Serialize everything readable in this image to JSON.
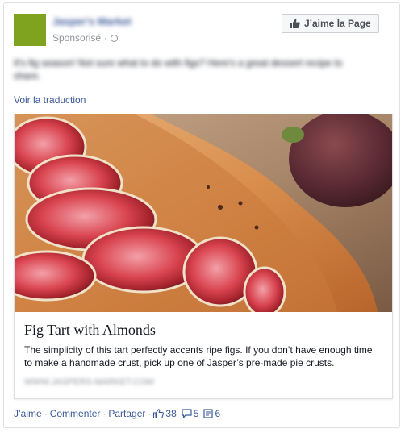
{
  "page": {
    "name": "Jasper's Market",
    "sponsored_label": "Sponsorisé",
    "like_page_button": "J’aime la Page"
  },
  "post": {
    "text": "It's fig season! Not sure what to do with figs? Here's a great dessert recipe to share.",
    "translate_link": "Voir la traduction"
  },
  "attachment": {
    "title": "Fig Tart with Almonds",
    "description": "The simplicity of this tart perfectly accents ripe figs. If you don’t have enough time to make a handmade crust, pick up one of Jasper’s pre-made pie crusts.",
    "domain": "WWW.JASPERS-MARKET.COM"
  },
  "actions": {
    "like": "J’aime",
    "comment": "Commenter",
    "share": "Partager",
    "separator": "·",
    "likes_count": "38",
    "comments_count": "5",
    "shares_count": "6"
  },
  "colors": {
    "link": "#3b5998",
    "avatar": "#7fa21f",
    "border": "#dddfe2",
    "muted": "#90949c"
  },
  "icons": [
    "thumbs-up-icon",
    "globe-icon",
    "comment-icon",
    "share-icon"
  ]
}
